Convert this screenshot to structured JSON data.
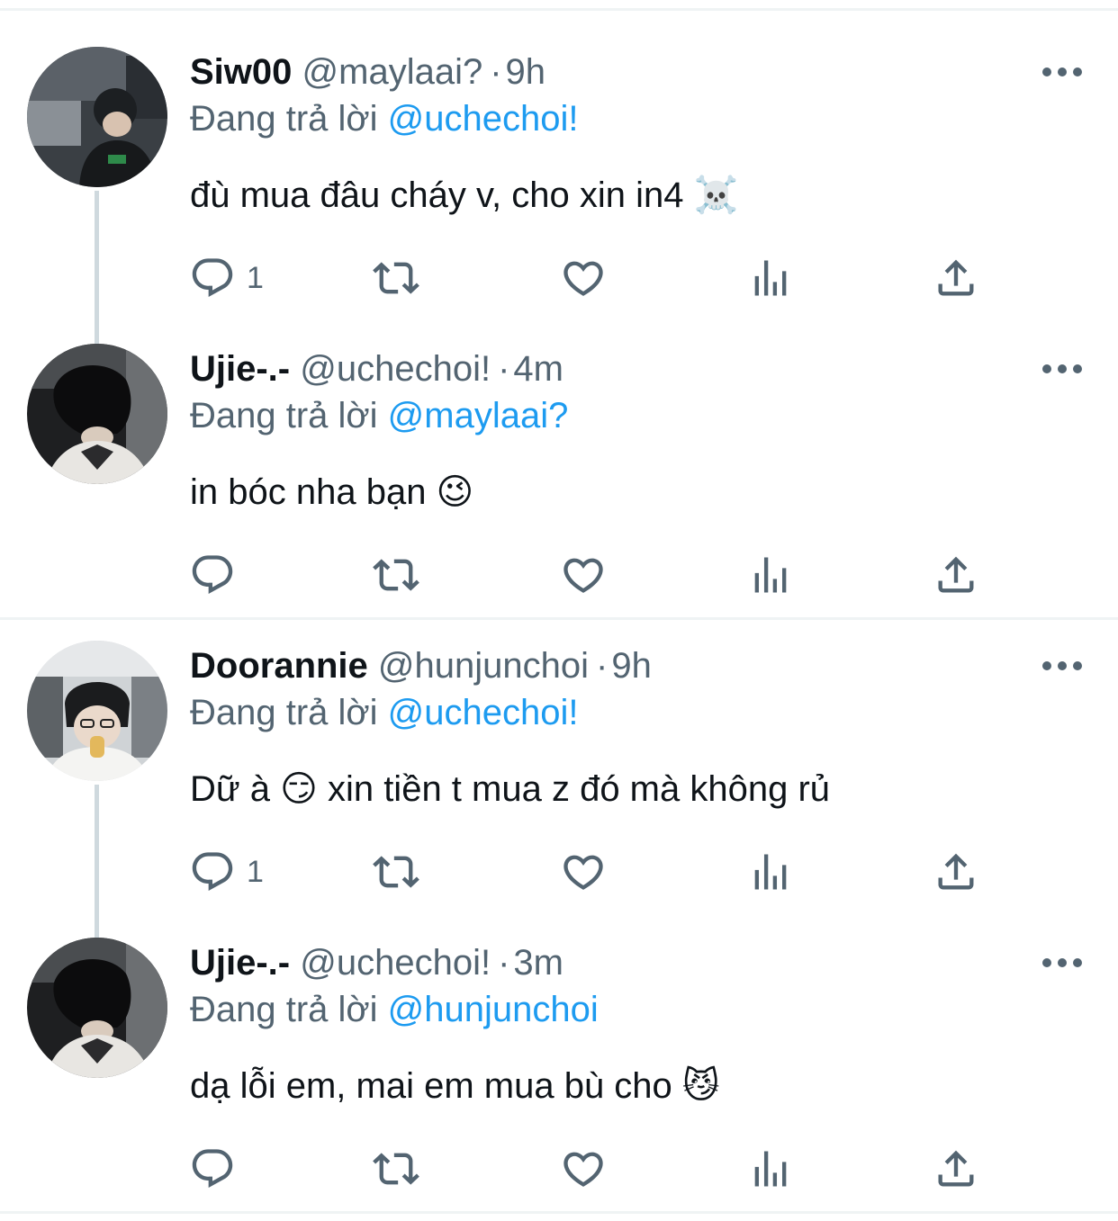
{
  "reply_prefix": "Đang trả lời",
  "tweets": [
    {
      "name": "Siw00",
      "handle": "@maylaai?",
      "time": "9h",
      "reply_to": "@uchechoi!",
      "text": "đù mua đâu cháy v, cho xin in4 ☠️",
      "reply_count": "1"
    },
    {
      "name": "Ujie-.-",
      "handle": "@uchechoi!",
      "time": "4m",
      "reply_to": "@maylaai?",
      "text": "in bóc nha bạn 😉",
      "reply_count": ""
    },
    {
      "name": "Doorannie",
      "handle": "@hunjunchoi",
      "time": "9h",
      "reply_to": "@uchechoi!",
      "text": "Dữ à 😏  xin tiền t mua z đó mà không rủ",
      "reply_count": "1"
    },
    {
      "name": "Ujie-.-",
      "handle": "@uchechoi!",
      "time": "3m",
      "reply_to": "@hunjunchoi",
      "text": "dạ lỗi em, mai em mua bù cho 😼",
      "reply_count": ""
    }
  ],
  "icons": {
    "reply": "reply-icon",
    "retweet": "retweet-icon",
    "like": "heart-icon",
    "views": "analytics-icon",
    "share": "share-icon",
    "more": "more-icon"
  },
  "colors": {
    "text": "#0f1419",
    "secondary": "#536471",
    "mention": "#1d9bf0",
    "divider": "#eff3f4",
    "thread_line": "#cfd9de"
  }
}
